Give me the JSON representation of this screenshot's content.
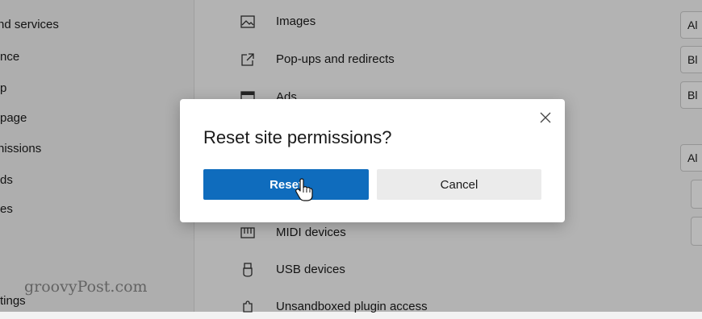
{
  "sidebar": {
    "items": [
      {
        "label": "nd services"
      },
      {
        "label": "nce"
      },
      {
        "label": "p"
      },
      {
        "label": "page"
      },
      {
        "label": "nissions"
      },
      {
        "label": "ds"
      },
      {
        "label": "es"
      },
      {
        "label": "tings"
      }
    ]
  },
  "permissions": [
    {
      "label": "Images",
      "icon": "image-icon"
    },
    {
      "label": "Pop-ups and redirects",
      "icon": "popup-icon"
    },
    {
      "label": "Ads",
      "icon": "ads-icon"
    },
    {
      "label": "MIDI devices",
      "icon": "midi-icon"
    },
    {
      "label": "USB devices",
      "icon": "usb-icon"
    },
    {
      "label": "Unsandboxed plugin access",
      "icon": "plugin-icon"
    }
  ],
  "right_selects": [
    {
      "label": "Al"
    },
    {
      "label": "Bl"
    },
    {
      "label": "Bl"
    },
    {
      "label": "Al"
    }
  ],
  "dialog": {
    "title": "Reset site permissions?",
    "reset_label": "Reset",
    "cancel_label": "Cancel",
    "close_icon": "close-icon"
  },
  "watermark": "groovyPost.com",
  "colors": {
    "accent": "#0f6cbd",
    "cancel_bg": "#ebebeb"
  }
}
